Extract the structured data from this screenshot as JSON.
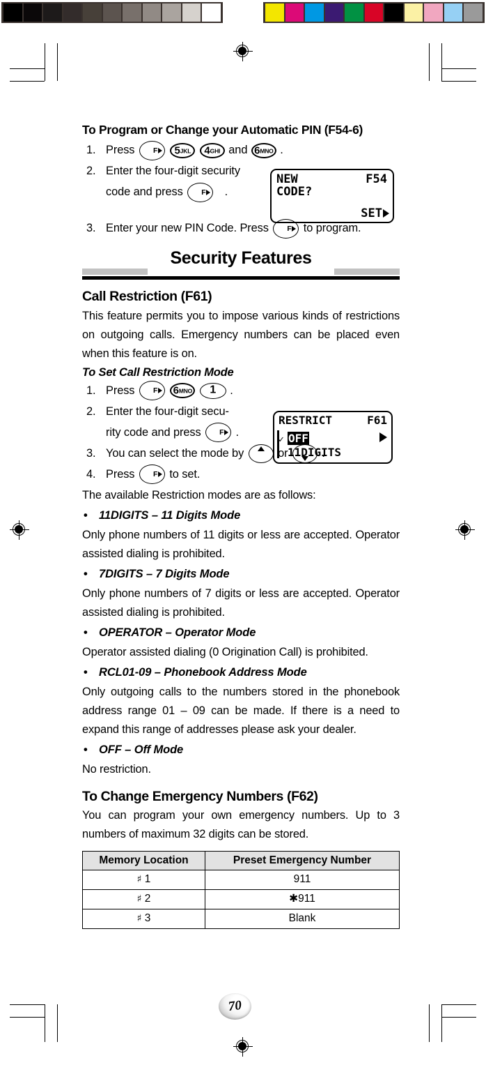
{
  "scan": {
    "gray_patches": [
      "#000000",
      "#0b0809",
      "#1d1a1a",
      "#332c2b",
      "#474039",
      "#5c544f",
      "#78706b",
      "#918a85",
      "#aaa49f",
      "#d6d2cd",
      "#ffffff"
    ],
    "color_patches": [
      "#f3e600",
      "#dc0a77",
      "#0098e3",
      "#3b1a72",
      "#019143",
      "#d80426",
      "#000000",
      "#fbf1a5",
      "#f1a7c0",
      "#96d0f4",
      "#9a9a9a"
    ]
  },
  "section_pin": {
    "heading": "To Program or Change your Automatic PIN (F54-6)",
    "steps": [
      {
        "num": "1.",
        "pre": "Press",
        "keys": [
          "F▸",
          "5JKL",
          "4GHI"
        ],
        "mid": "and",
        "key_last": "6MNO",
        "post": "."
      },
      {
        "num": "2.",
        "line1": "Enter the four-digit security",
        "line2_pre": "code and press",
        "line2_key": "F▸",
        "line2_post": "."
      },
      {
        "num": "3.",
        "pre": "Enter your new PIN Code. Press",
        "key": "F▸",
        "post": "to program."
      }
    ],
    "lcd": {
      "line1_left": "NEW",
      "line1_right": "F54",
      "line2_left": "CODE?",
      "line_bottom_right": "SET"
    }
  },
  "banner": {
    "title": "Security Features"
  },
  "call_restriction": {
    "heading": "Call Restriction (F61)",
    "intro": "This feature permits you to impose various kinds of restrictions on outgoing calls. Emergency numbers can be placed even when this feature is on.",
    "sub_heading": "To Set Call Restriction Mode",
    "steps": [
      {
        "num": "1.",
        "pre": "Press",
        "keys": [
          "F▸",
          "6MNO",
          "1"
        ],
        "post": "."
      },
      {
        "num": "2.",
        "line1": "Enter the four-digit secu-",
        "line2_pre": "rity code and press",
        "line2_key": "F▸",
        "line2_post": "."
      },
      {
        "num": "3.",
        "pre": "You can select the mode by",
        "mid": "or",
        "post": ".",
        "key_up": "up-arrow",
        "key_down": "down-arrow"
      },
      {
        "num": "4.",
        "pre": "Press",
        "key": "F▸",
        "post": "to set."
      }
    ],
    "lcd": {
      "title": "RESTRICT",
      "code": "F61",
      "option_selected": "OFF",
      "option_next": "11DIGITS",
      "check_glyph": "✓"
    },
    "modes_intro": "The available Restriction modes are as follows:",
    "modes": [
      {
        "bullet": "•",
        "label": "11DIGITS – 11 Digits Mode",
        "desc": "Only phone numbers of 11 digits or less are accepted. Operator assisted dialing is prohibited."
      },
      {
        "bullet": "•",
        "label": "7DIGITS – 7 Digits Mode",
        "desc": "Only phone numbers of 7 digits or less are accepted. Operator assisted dialing is prohibited."
      },
      {
        "bullet": "•",
        "label": "OPERATOR – Operator Mode",
        "desc": "Operator assisted dialing (0 Origination Call) is prohibited."
      },
      {
        "bullet": "•",
        "label": "RCL01-09 – Phonebook Address Mode",
        "desc": "Only outgoing calls to the numbers stored in the phonebook address range 01 – 09 can be made. If there is a need to expand this range of addresses please ask your dealer."
      },
      {
        "bullet": "•",
        "label": "OFF – Off Mode",
        "desc": "No restriction."
      }
    ]
  },
  "emergency": {
    "heading": "To Change Emergency Numbers (F62)",
    "intro": "You can program your own emergency numbers. Up to 3 numbers of maximum 32 digits can be stored.",
    "table": {
      "headers": [
        "Memory Location",
        "Preset Emergency Number"
      ],
      "rows": [
        {
          "hash": "♯",
          "location": "1",
          "number": "911"
        },
        {
          "hash": "♯",
          "location": "2",
          "number": "✱911"
        },
        {
          "hash": "♯",
          "location": "3",
          "number": "Blank"
        }
      ]
    }
  },
  "footer": {
    "page_number": "70"
  }
}
